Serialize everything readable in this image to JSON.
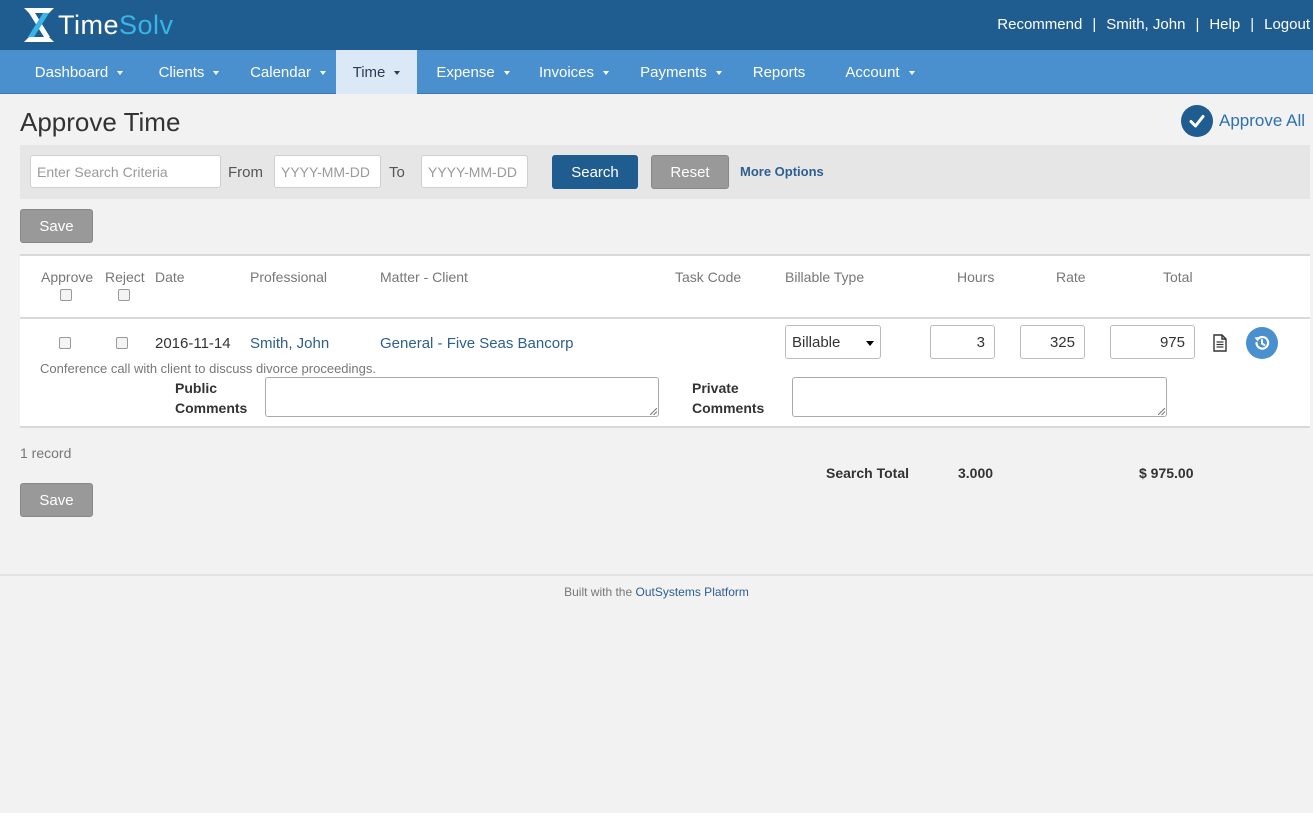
{
  "brand": {
    "name_part1": "Time",
    "name_part2": "Solv",
    "colors": {
      "header": "#1f5c8f",
      "nav": "#4a8fce",
      "accent": "#3ab4e6"
    }
  },
  "header_links": {
    "recommend": "Recommend",
    "user": "Smith, John",
    "help": "Help",
    "logout": "Logout",
    "separator": "|"
  },
  "nav": {
    "items": [
      {
        "label": "Dashboard"
      },
      {
        "label": "Clients"
      },
      {
        "label": "Calendar"
      },
      {
        "label": "Time",
        "active": true
      },
      {
        "label": "Expense"
      },
      {
        "label": "Invoices"
      },
      {
        "label": "Payments"
      },
      {
        "label": "Reports"
      },
      {
        "label": "Account"
      }
    ]
  },
  "page": {
    "title": "Approve Time",
    "approve_all": "Approve All"
  },
  "search": {
    "criteria_placeholder": "Enter Search Criteria",
    "from_label": "From",
    "from_placeholder": "YYYY-MM-DD",
    "to_label": "To",
    "to_placeholder": "YYYY-MM-DD",
    "search_button": "Search",
    "reset_button": "Reset",
    "more_options": "More Options"
  },
  "actions": {
    "save": "Save"
  },
  "table": {
    "headers": {
      "approve": "Approve",
      "reject": "Reject",
      "date": "Date",
      "professional": "Professional",
      "matter_client": "Matter - Client",
      "task_code": "Task Code",
      "billable_type": "Billable Type",
      "hours": "Hours",
      "rate": "Rate",
      "total": "Total"
    },
    "rows": [
      {
        "approve": false,
        "reject": false,
        "date": "2016-11-14",
        "professional": "Smith, John",
        "matter_client": "General - Five Seas Bancorp",
        "task_code": "",
        "billable_type": "Billable",
        "hours": "3",
        "rate": "325",
        "total": "975",
        "description": "Conference call with client to discuss divorce proceedings.",
        "public_comments_label_1": "Public",
        "public_comments_label_2": "Comments",
        "private_comments_label_1": "Private",
        "private_comments_label_2": "Comments",
        "public_comments": "",
        "private_comments": ""
      }
    ]
  },
  "summary": {
    "records": "1 record",
    "search_total_label": "Search Total",
    "hours_total": "3.000",
    "amount_total": "$ 975.00"
  },
  "footer": {
    "prefix": "Built with the",
    "link": "OutSystems Platform"
  }
}
